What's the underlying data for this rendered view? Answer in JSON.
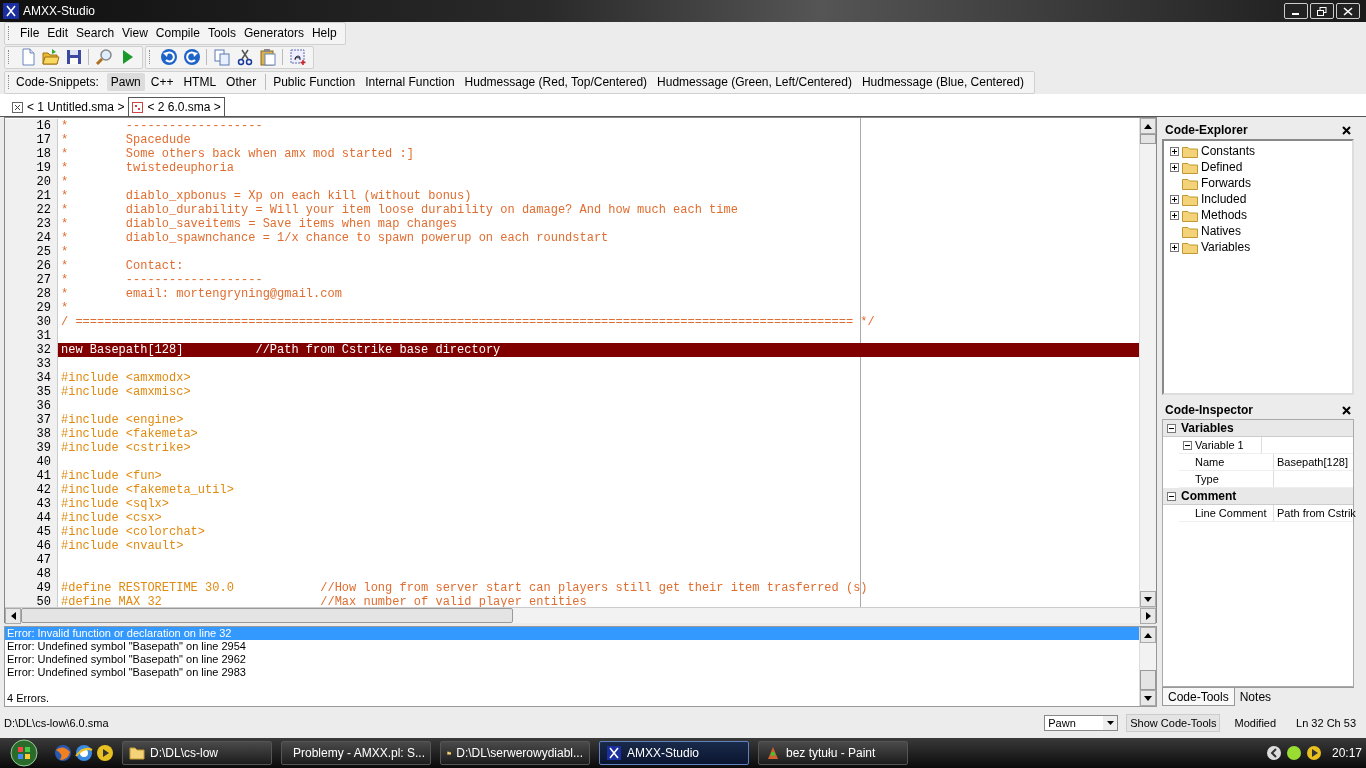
{
  "window": {
    "title": "AMXX-Studio"
  },
  "menu": [
    "File",
    "Edit",
    "Search",
    "View",
    "Compile",
    "Tools",
    "Generators",
    "Help"
  ],
  "snippets": {
    "label": "Code-Snippets:",
    "languages": [
      {
        "label": "Pawn",
        "selected": true
      },
      {
        "label": "C++",
        "selected": false
      },
      {
        "label": "HTML",
        "selected": false
      },
      {
        "label": "Other",
        "selected": false
      }
    ],
    "items": [
      "Public Function",
      "Internal Function",
      "Hudmessage (Red, Top/Centered)",
      "Hudmessage (Green, Left/Centered)",
      "Hudmessage (Blue, Centered)"
    ]
  },
  "tabs": [
    {
      "label": "< 1 Untitled.sma >",
      "selected": false
    },
    {
      "label": "< 2 6.0.sma >",
      "selected": true
    }
  ],
  "editor": {
    "lines": [
      {
        "number": "16",
        "kind": "comment",
        "code": "*        -------------------",
        "selected": false
      },
      {
        "number": "17",
        "kind": "comment",
        "code": "*        Spacedude",
        "selected": false
      },
      {
        "number": "18",
        "kind": "comment",
        "code": "*        Some others back when amx mod started :]",
        "selected": false
      },
      {
        "number": "19",
        "kind": "comment",
        "code": "*        twistedeuphoria",
        "selected": false
      },
      {
        "number": "20",
        "kind": "comment",
        "code": "*",
        "selected": false
      },
      {
        "number": "21",
        "kind": "comment",
        "code": "*        diablo_xpbonus = Xp on each kill (without bonus)",
        "selected": false
      },
      {
        "number": "22",
        "kind": "comment",
        "code": "*        diablo_durability = Will your item loose durability on damage? And how much each time",
        "selected": false
      },
      {
        "number": "23",
        "kind": "comment",
        "code": "*        diablo_saveitems = Save items when map changes",
        "selected": false
      },
      {
        "number": "24",
        "kind": "comment",
        "code": "*        diablo_spawnchance = 1/x chance to spawn powerup on each roundstart",
        "selected": false
      },
      {
        "number": "25",
        "kind": "comment",
        "code": "*",
        "selected": false
      },
      {
        "number": "26",
        "kind": "comment",
        "code": "*        Contact:",
        "selected": false
      },
      {
        "number": "27",
        "kind": "comment",
        "code": "*        -------------------",
        "selected": false
      },
      {
        "number": "28",
        "kind": "comment",
        "code": "*        email: mortengryning@gmail.com",
        "selected": false
      },
      {
        "number": "29",
        "kind": "comment",
        "code": "*",
        "selected": false
      },
      {
        "number": "30",
        "kind": "comment",
        "code": "/ ============================================================================================================ */",
        "selected": false
      },
      {
        "number": "31",
        "kind": "blank",
        "selected": false
      },
      {
        "number": "32",
        "kind": "code",
        "code": "new Basepath[128]          ",
        "comment": "//Path from Cstrike base directory",
        "selected": true
      },
      {
        "number": "33",
        "kind": "blank",
        "selected": false
      },
      {
        "number": "34",
        "kind": "directive",
        "code": "#include <amxmodx>",
        "selected": false
      },
      {
        "number": "35",
        "kind": "directive",
        "code": "#include <amxmisc>",
        "selected": false
      },
      {
        "number": "36",
        "kind": "blank",
        "selected": false
      },
      {
        "number": "37",
        "kind": "directive",
        "code": "#include <engine>",
        "selected": false
      },
      {
        "number": "38",
        "kind": "directive",
        "code": "#include <fakemeta>",
        "selected": false
      },
      {
        "number": "39",
        "kind": "directive",
        "code": "#include <cstrike>",
        "selected": false
      },
      {
        "number": "40",
        "kind": "blank",
        "selected": false
      },
      {
        "number": "41",
        "kind": "directive",
        "code": "#include <fun>",
        "selected": false
      },
      {
        "number": "42",
        "kind": "directive",
        "code": "#include <fakemeta_util>",
        "selected": false
      },
      {
        "number": "43",
        "kind": "directive",
        "code": "#include <sqlx>",
        "selected": false
      },
      {
        "number": "44",
        "kind": "directive",
        "code": "#include <csx>",
        "selected": false
      },
      {
        "number": "45",
        "kind": "directive",
        "code": "#include <colorchat>",
        "selected": false
      },
      {
        "number": "46",
        "kind": "directive",
        "code": "#include <nvault>",
        "selected": false
      },
      {
        "number": "47",
        "kind": "blank",
        "selected": false
      },
      {
        "number": "48",
        "kind": "blank",
        "selected": false
      },
      {
        "number": "49",
        "kind": "directive",
        "code": "#define RESTORETIME 30.0            ",
        "comment": "//How long from server start can players still get their item trasferred (s)",
        "selected": false
      },
      {
        "number": "50",
        "kind": "directive",
        "code": "#define MAX 32                      ",
        "comment": "//Max number of valid player entities",
        "selected": false
      }
    ]
  },
  "output": {
    "messages": [
      {
        "text": "Error: Invalid function or declaration on line 32",
        "selected": true
      },
      {
        "text": "Error: Undefined symbol \"Basepath\" on line 2954",
        "selected": false
      },
      {
        "text": "Error: Undefined symbol \"Basepath\" on line 2962",
        "selected": false
      },
      {
        "text": "Error: Undefined symbol \"Basepath\" on line 2983",
        "selected": false
      }
    ],
    "summary": "4 Errors."
  },
  "code_explorer": {
    "title": "Code-Explorer",
    "items": [
      {
        "label": "Constants",
        "has_children": true
      },
      {
        "label": "Defined",
        "has_children": true
      },
      {
        "label": "Forwards",
        "has_children": false
      },
      {
        "label": "Included",
        "has_children": true
      },
      {
        "label": "Methods",
        "has_children": true
      },
      {
        "label": "Natives",
        "has_children": false
      },
      {
        "label": "Variables",
        "has_children": true
      }
    ]
  },
  "code_inspector": {
    "title": "Code-Inspector",
    "sections": [
      {
        "title": "Variables",
        "expanded": true,
        "groups": [
          {
            "title": "Variable 1",
            "expanded": true,
            "rows": [
              {
                "name": "Name",
                "value": "Basepath[128]"
              },
              {
                "name": "Type"
              }
            ]
          }
        ]
      },
      {
        "title": "Comment",
        "expanded": true,
        "rows": [
          {
            "name": "Line Comment",
            "value": "Path from Cstrik"
          }
        ]
      }
    ]
  },
  "panel_tabs": [
    {
      "label": "Code-Tools",
      "selected": true
    },
    {
      "label": "Notes",
      "selected": false
    }
  ],
  "status_bar": {
    "path": "D:\\DL\\cs-low\\6.0.sma",
    "language": "Pawn",
    "button": "Show Code-Tools",
    "state": "Modified",
    "position": "Ln 32 Ch 53"
  },
  "taskbar": {
    "tasks": [
      {
        "kind": "folder",
        "label": "D:\\DL\\cs-low",
        "selected": false
      },
      {
        "kind": "browser",
        "label": "Problemy - AMXX.pl: S...",
        "selected": false
      },
      {
        "kind": "folder",
        "label": "D:\\DL\\serwerowydiabl...",
        "selected": false
      },
      {
        "kind": "studio",
        "label": "AMXX-Studio",
        "selected": true
      },
      {
        "kind": "paint",
        "label": "bez tytułu - Paint",
        "selected": false
      }
    ],
    "clock": "20:17"
  }
}
